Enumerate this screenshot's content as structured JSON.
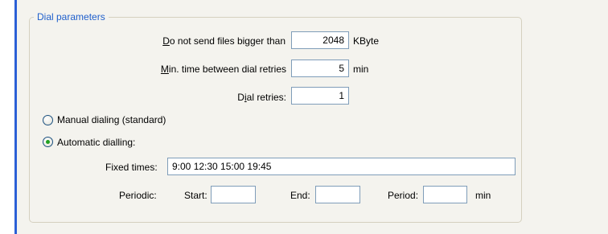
{
  "group": {
    "title": "Dial parameters"
  },
  "max_file_size": {
    "label_ul": "D",
    "label_rest": "o not send files bigger than",
    "value": "2048",
    "unit": "KByte"
  },
  "min_time": {
    "label_ul": "M",
    "label_rest": "in. time between dial retries",
    "value": "5",
    "unit": "min"
  },
  "dial_retries": {
    "label_pre": "D",
    "label_ul": "i",
    "label_rest": "al retries:",
    "value": "1"
  },
  "dial_mode": {
    "manual_label": "Manual dialing (standard)",
    "automatic_label": "Automatic dialling:",
    "selected": "automatic"
  },
  "fixed_times": {
    "label": "Fixed times:",
    "value": "9:00 12:30 15:00 19:45"
  },
  "periodic": {
    "label": "Periodic:",
    "start_label": "Start:",
    "start_value": "",
    "end_label": "End:",
    "end_value": "",
    "period_label": "Period:",
    "period_value": "",
    "unit": "min"
  },
  "colors": {
    "accent_line": "#2b5fd6",
    "title_text": "#1f5fcc",
    "radio_dot": "#21a121"
  }
}
